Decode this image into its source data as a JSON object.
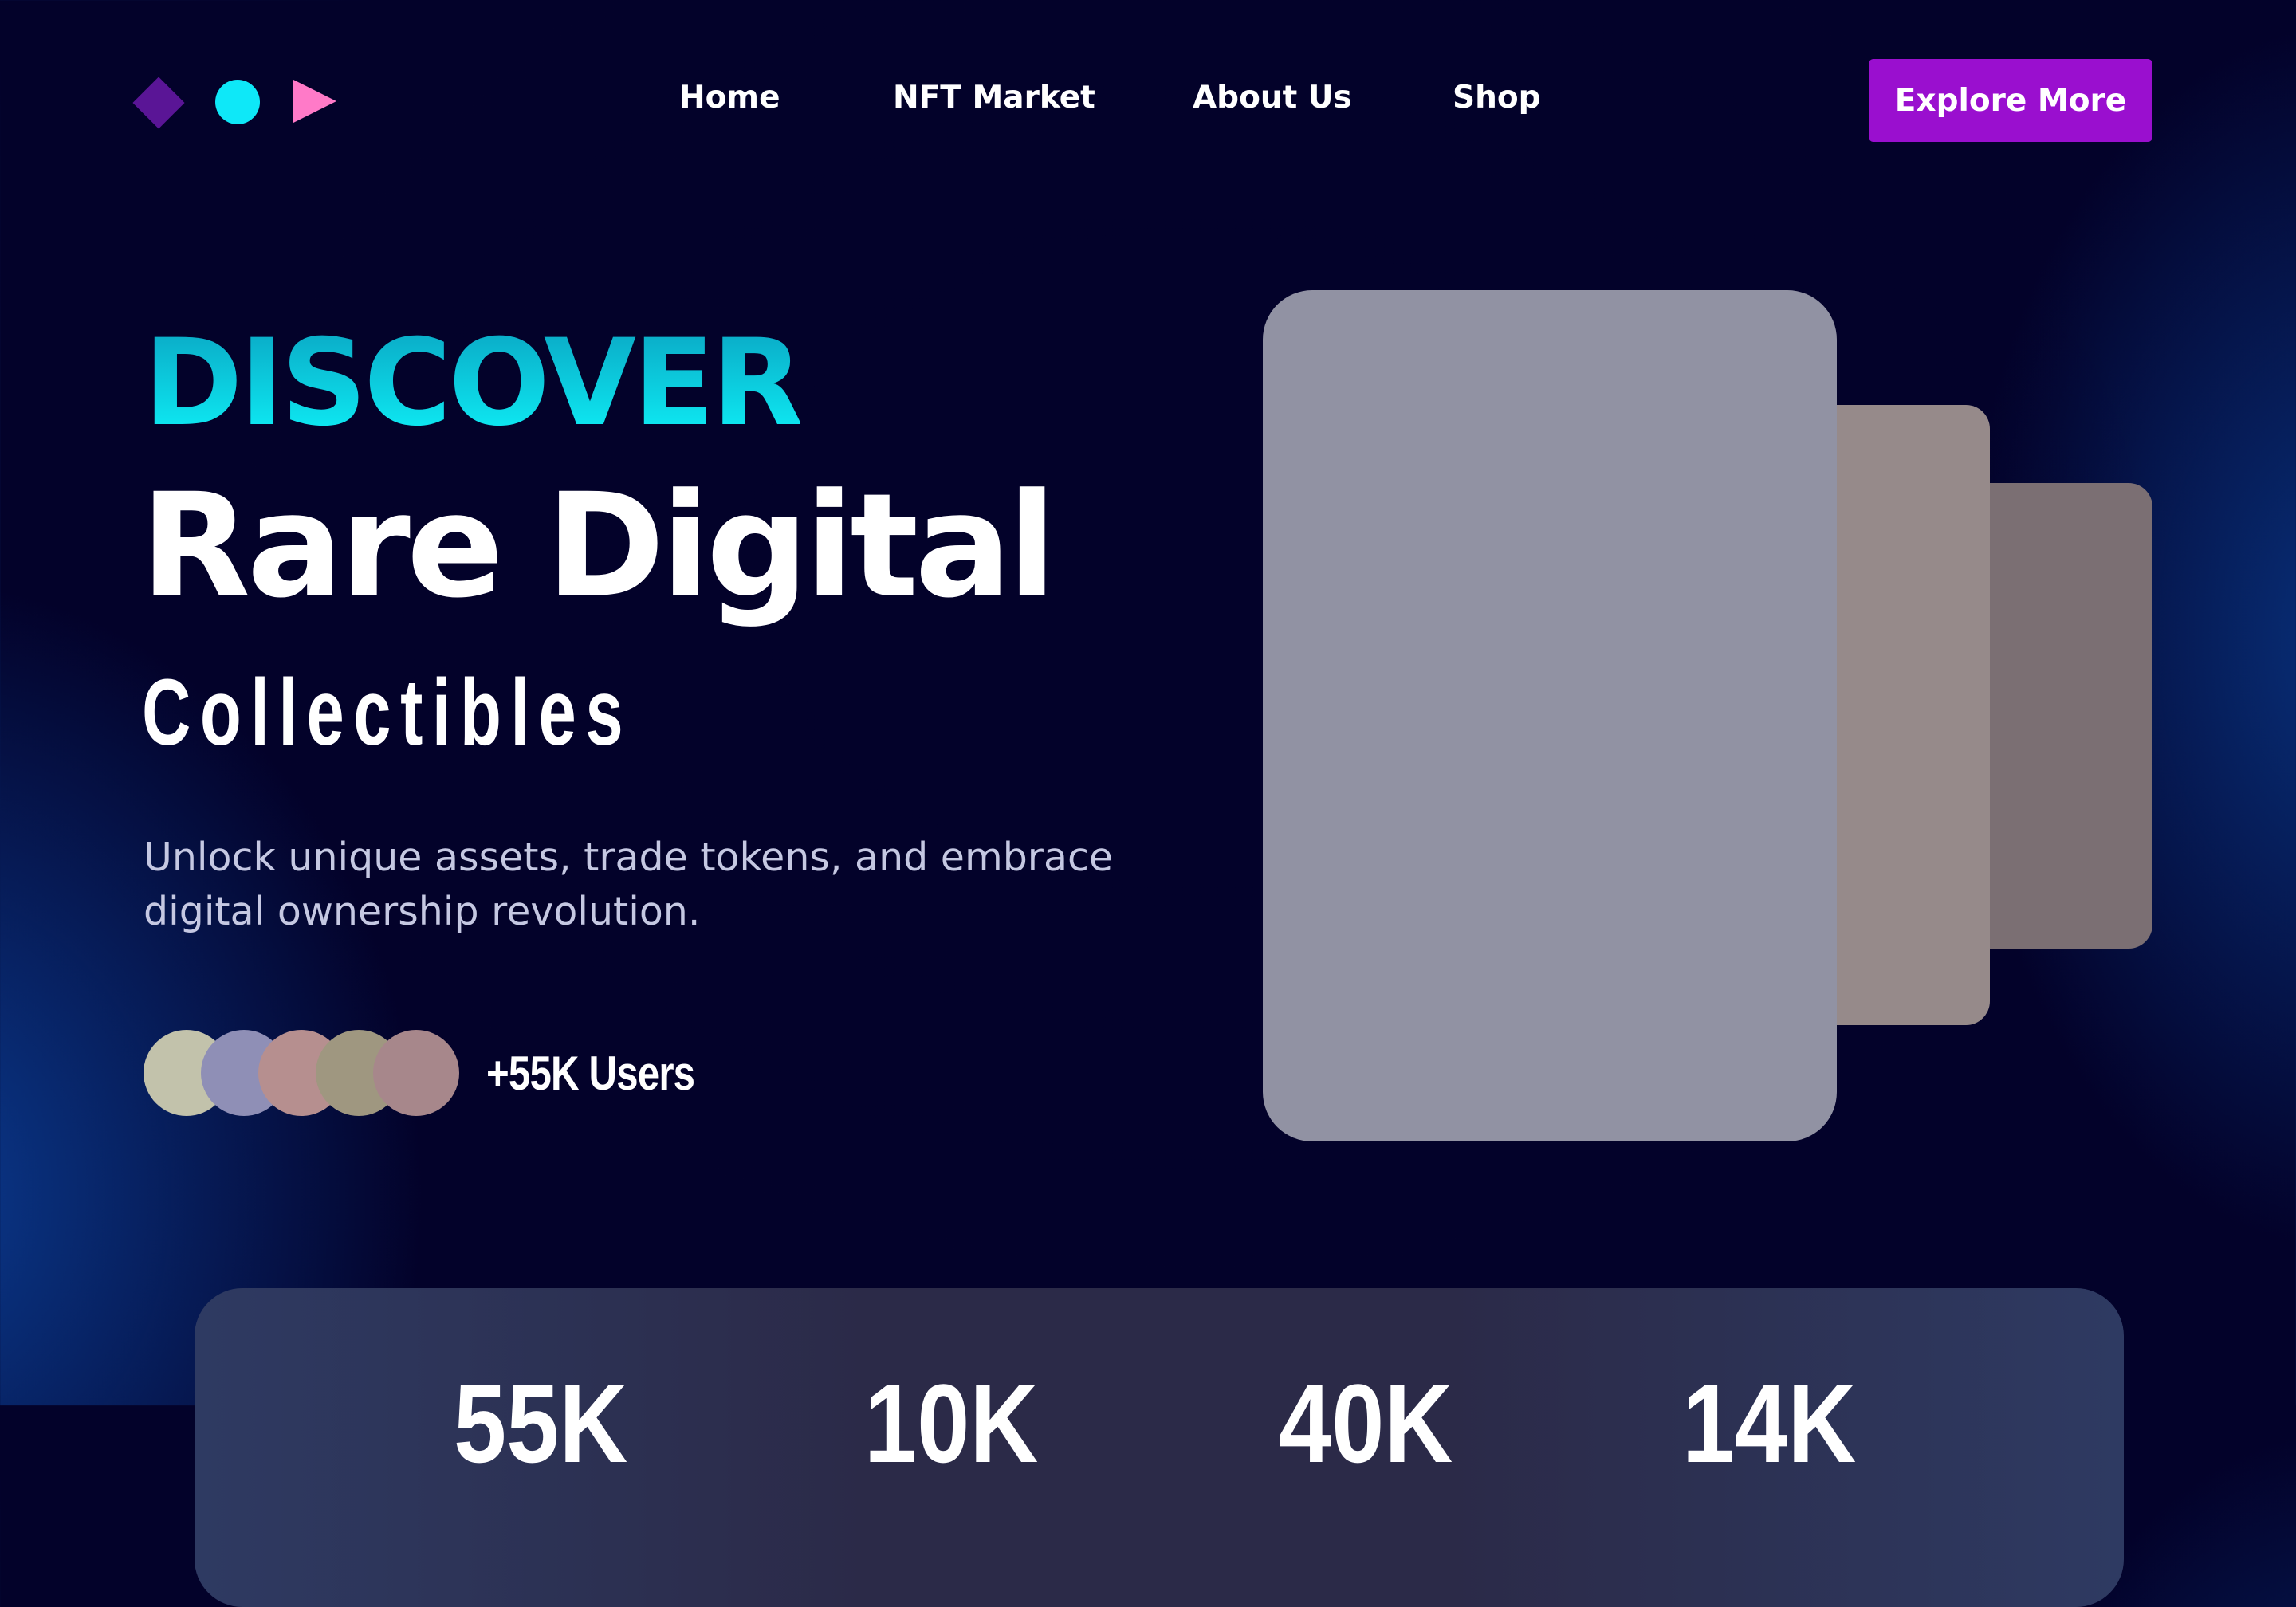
{
  "nav": {
    "items": [
      "Home",
      "NFT Market",
      "About Us",
      "Shop"
    ],
    "cta_label": "Explore More"
  },
  "logo": {
    "icons": [
      "diamond-icon",
      "circle-icon",
      "play-triangle-icon"
    ],
    "colors": [
      "#5a1596",
      "#0ee8f8",
      "#ff7ac8"
    ]
  },
  "hero": {
    "eyebrow": "DISCOVER",
    "title": "Rare Digital",
    "subtitle": "Collectibles",
    "description": "Unlock unique assets, trade tokens, and embrace digital ownership revolution.",
    "users_label": "+55K Users"
  },
  "avatars": {
    "colors": [
      "#c2c2ab",
      "#8f8fb6",
      "#b68f8f",
      "#9f9780",
      "#a7878b"
    ]
  },
  "cards": {
    "colors": [
      "#9192a3",
      "#968a8a",
      "#7b6f73"
    ]
  },
  "stats": {
    "values": [
      "55K",
      "10K",
      "40K",
      "14K"
    ]
  },
  "colors": {
    "accent": "#9a0fcf",
    "cyan": "#0ef0f7",
    "background": "#03022a"
  }
}
